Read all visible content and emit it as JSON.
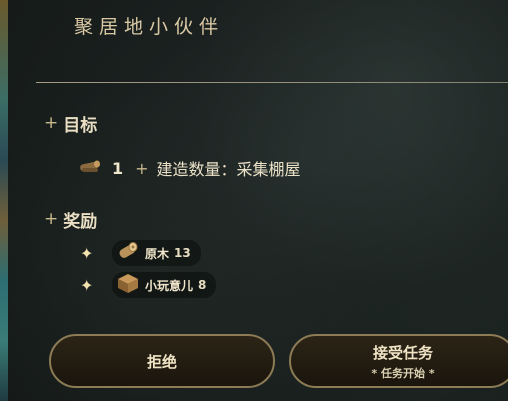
{
  "title": "聚居地小伙伴",
  "objective": {
    "heading": "目标",
    "count": "1",
    "text": "建造数量：采集棚屋"
  },
  "rewards": {
    "heading": "奖励",
    "items": [
      {
        "name": "原木",
        "qty": "13"
      },
      {
        "name": "小玩意儿",
        "qty": "8"
      }
    ]
  },
  "buttons": {
    "reject": "拒绝",
    "accept": "接受任务",
    "accept_sub": "* 任务开始 *"
  }
}
